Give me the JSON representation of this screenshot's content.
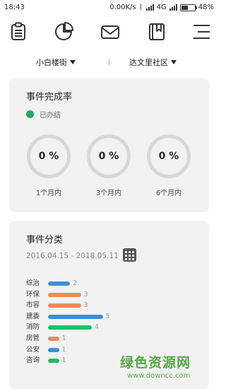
{
  "status": {
    "time": "18:43",
    "net_speed": "0.00K/s",
    "network": "4G",
    "battery": "48%",
    "battery_level": 0.48
  },
  "toolbar": {
    "icons": [
      "clipboard-icon",
      "pie-chart-icon",
      "mail-icon",
      "bookmark-book-icon",
      "menu-icon"
    ]
  },
  "filters": {
    "street": "小白楼街",
    "community": "达文里社区"
  },
  "completion": {
    "title": "事件完成率",
    "legend_label": "已办结",
    "legend_color": "#1ea866",
    "rings": [
      {
        "value": "0 %",
        "label": "1个月内"
      },
      {
        "value": "0 %",
        "label": "3个月内"
      },
      {
        "value": "0 %",
        "label": "6个月内"
      }
    ]
  },
  "category": {
    "title": "事件分类",
    "date_range": "2016.04.15 - 2018.05.11",
    "chart_data": {
      "type": "bar",
      "orientation": "horizontal",
      "categories": [
        "综治",
        "环保",
        "市容",
        "建委",
        "消防",
        "房管",
        "公安",
        "咨询"
      ],
      "values": [
        2,
        3,
        3,
        5,
        4,
        1,
        1,
        1
      ],
      "colors": [
        "#3d8fd8",
        "#ee8a5a",
        "#ee8a5a",
        "#3d8fd8",
        "#1ebf64",
        "#ee8a5a",
        "#3d8fd8",
        "#1ebf64"
      ]
    }
  },
  "watermark": {
    "main": "绿色资源网",
    "url": "www.downcc.com"
  }
}
